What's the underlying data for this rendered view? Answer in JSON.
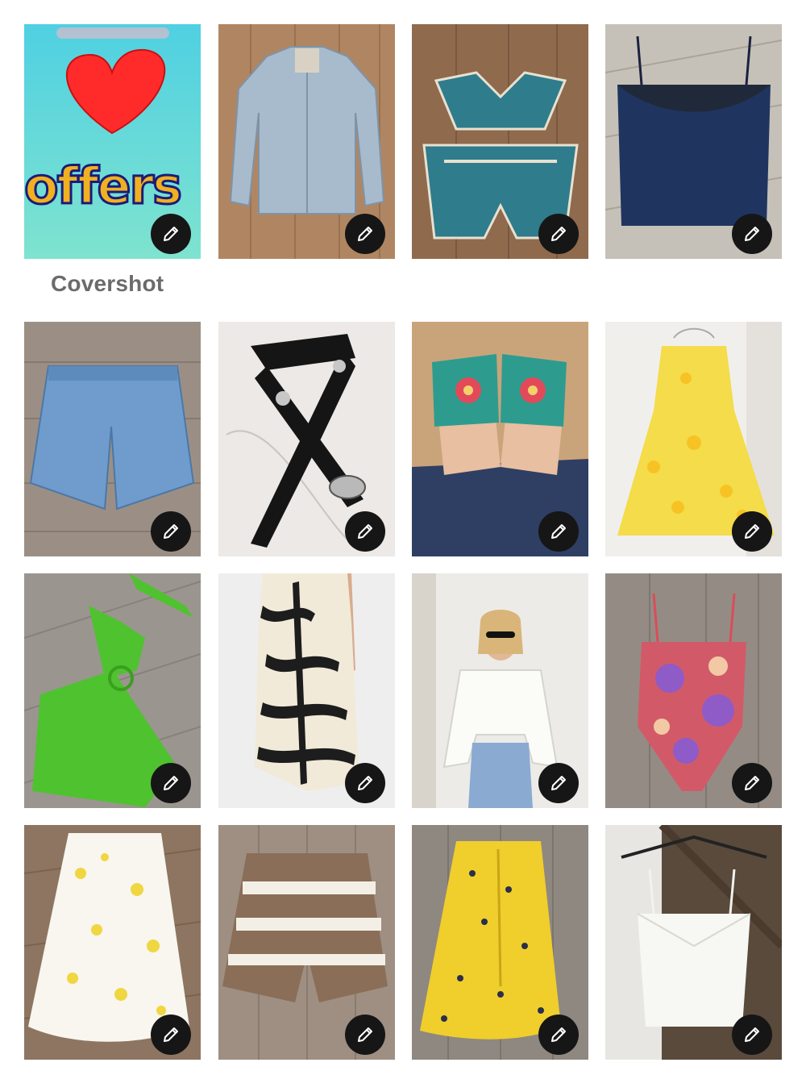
{
  "listing_photos": {
    "cover_label": "Covershot",
    "cover_image_text": "offers",
    "items": [
      {
        "icon": "heart-offers-graphic",
        "edit_icon": "pencil-icon"
      },
      {
        "icon": "denim-jacket",
        "edit_icon": "pencil-icon"
      },
      {
        "icon": "crochet-set",
        "edit_icon": "pencil-icon"
      },
      {
        "icon": "navy-cami",
        "edit_icon": "pencil-icon"
      },
      {
        "icon": "denim-shorts",
        "edit_icon": "pencil-icon"
      },
      {
        "icon": "black-belt",
        "edit_icon": "pencil-icon"
      },
      {
        "icon": "embroidered-slides",
        "edit_icon": "pencil-icon"
      },
      {
        "icon": "yellow-floral-dress",
        "edit_icon": "pencil-icon"
      },
      {
        "icon": "green-crochet-dress",
        "edit_icon": "pencil-icon"
      },
      {
        "icon": "zebra-print-skirt",
        "edit_icon": "pencil-icon"
      },
      {
        "icon": "eyelet-tie-top",
        "edit_icon": "pencil-icon"
      },
      {
        "icon": "floral-swimsuit",
        "edit_icon": "pencil-icon"
      },
      {
        "icon": "white-floral-skirt",
        "edit_icon": "pencil-icon"
      },
      {
        "icon": "crochet-shorts",
        "edit_icon": "pencil-icon"
      },
      {
        "icon": "yellow-ruched-skirt",
        "edit_icon": "pencil-icon"
      },
      {
        "icon": "white-cami",
        "edit_icon": "pencil-icon"
      }
    ]
  }
}
